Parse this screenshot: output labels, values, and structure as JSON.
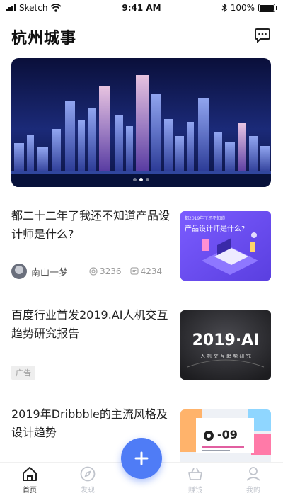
{
  "status_bar": {
    "carrier": "Sketch",
    "time": "9:41 AM",
    "battery": "100%"
  },
  "header": {
    "title": "杭州城事",
    "message_icon": "chat-bubble-icon"
  },
  "banner": {
    "slide_count": 3,
    "active_slide": 1
  },
  "articles": [
    {
      "title": "都二十二年了我还不知道产品设计师是什么?",
      "author": "南山一梦",
      "views": "3236",
      "comments": "4234",
      "thumb": {
        "top_text": "都2019年了还不知道",
        "headline": "产品设计师是什么?"
      }
    },
    {
      "title": "百度行业首发2019.AI人机交互趋势研究报告",
      "badge": "广告",
      "thumb": {
        "headline": "2019·AI",
        "subline": "人 机 交 互 趋 势 研 究"
      }
    },
    {
      "title": "2019年Dribbble的主流风格及设计趋势",
      "thumb": {
        "headline": "-09"
      }
    }
  ],
  "tabbar": {
    "tabs": [
      {
        "label": "首页",
        "icon": "home-icon",
        "active": true
      },
      {
        "label": "发现",
        "icon": "compass-icon",
        "active": false
      },
      {
        "label": "赚钱",
        "icon": "basket-icon",
        "active": false
      },
      {
        "label": "我的",
        "icon": "user-icon",
        "active": false
      }
    ],
    "fab_icon": "plus-icon"
  },
  "colors": {
    "accent": "#4f7cf6",
    "thumb1_bg": "#6a4cf0"
  }
}
